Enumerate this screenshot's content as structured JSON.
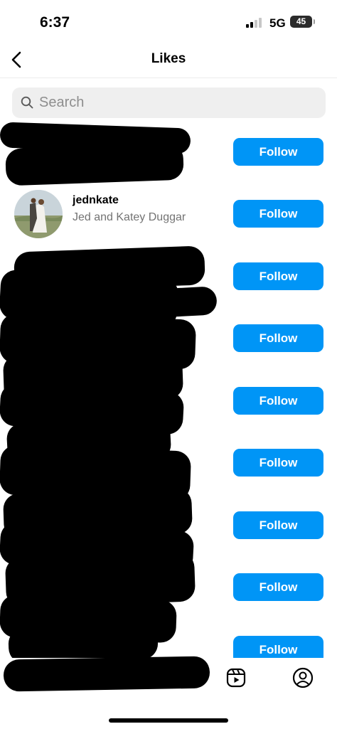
{
  "status_bar": {
    "time": "6:37",
    "network": "5G",
    "battery": "45"
  },
  "header": {
    "title": "Likes"
  },
  "search": {
    "placeholder": "Search"
  },
  "rows": [
    {
      "username": "",
      "full_name": "",
      "follow_label": "Follow"
    },
    {
      "username": "jednkate",
      "full_name": "Jed and Katey Duggar",
      "follow_label": "Follow"
    },
    {
      "username": "",
      "full_name": "",
      "follow_label": "Follow"
    },
    {
      "username": "",
      "full_name": "",
      "follow_label": "Follow"
    },
    {
      "username": "",
      "full_name": "",
      "follow_label": "Follow"
    },
    {
      "username": "",
      "full_name": "",
      "follow_label": "Follow"
    },
    {
      "username": "",
      "full_name": "",
      "follow_label": "Follow"
    },
    {
      "username": "",
      "full_name": "",
      "follow_label": "Follow"
    },
    {
      "username": "",
      "full_name": "",
      "follow_label": "Follow"
    }
  ],
  "tab_bar": {
    "icons": [
      "home-icon",
      "search-icon",
      "create-icon",
      "reels-icon",
      "profile-icon"
    ]
  },
  "colors": {
    "follow_button": "#0095f6",
    "secondary_text": "#737373",
    "search_background": "#efefef"
  }
}
